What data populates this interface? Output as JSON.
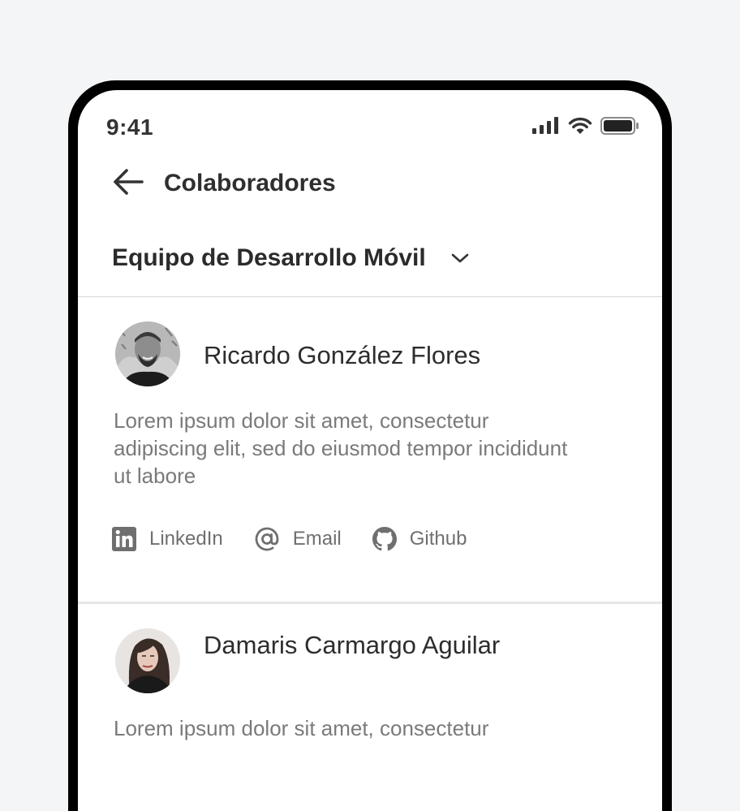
{
  "status_bar": {
    "time": "9:41"
  },
  "header": {
    "title": "Colaboradores"
  },
  "team": {
    "name": "Equipo de Desarrollo Móvil"
  },
  "members": [
    {
      "name": "Ricardo González Flores",
      "bio": "Lorem ipsum dolor sit amet, consectetur adipiscing elit, sed do eiusmod tempor incididunt ut labore",
      "links": [
        {
          "label": "LinkedIn",
          "icon": "linkedin-icon"
        },
        {
          "label": "Email",
          "icon": "at-sign-icon"
        },
        {
          "label": "Github",
          "icon": "github-icon"
        }
      ]
    },
    {
      "name": "Damaris Carmargo Aguilar",
      "bio": "Lorem ipsum dolor sit amet, consectetur"
    }
  ],
  "colors": {
    "background": "#f4f5f7",
    "text_primary": "#2d2d2d",
    "text_secondary": "#7a7a7a",
    "icon": "#6f6f6f"
  }
}
